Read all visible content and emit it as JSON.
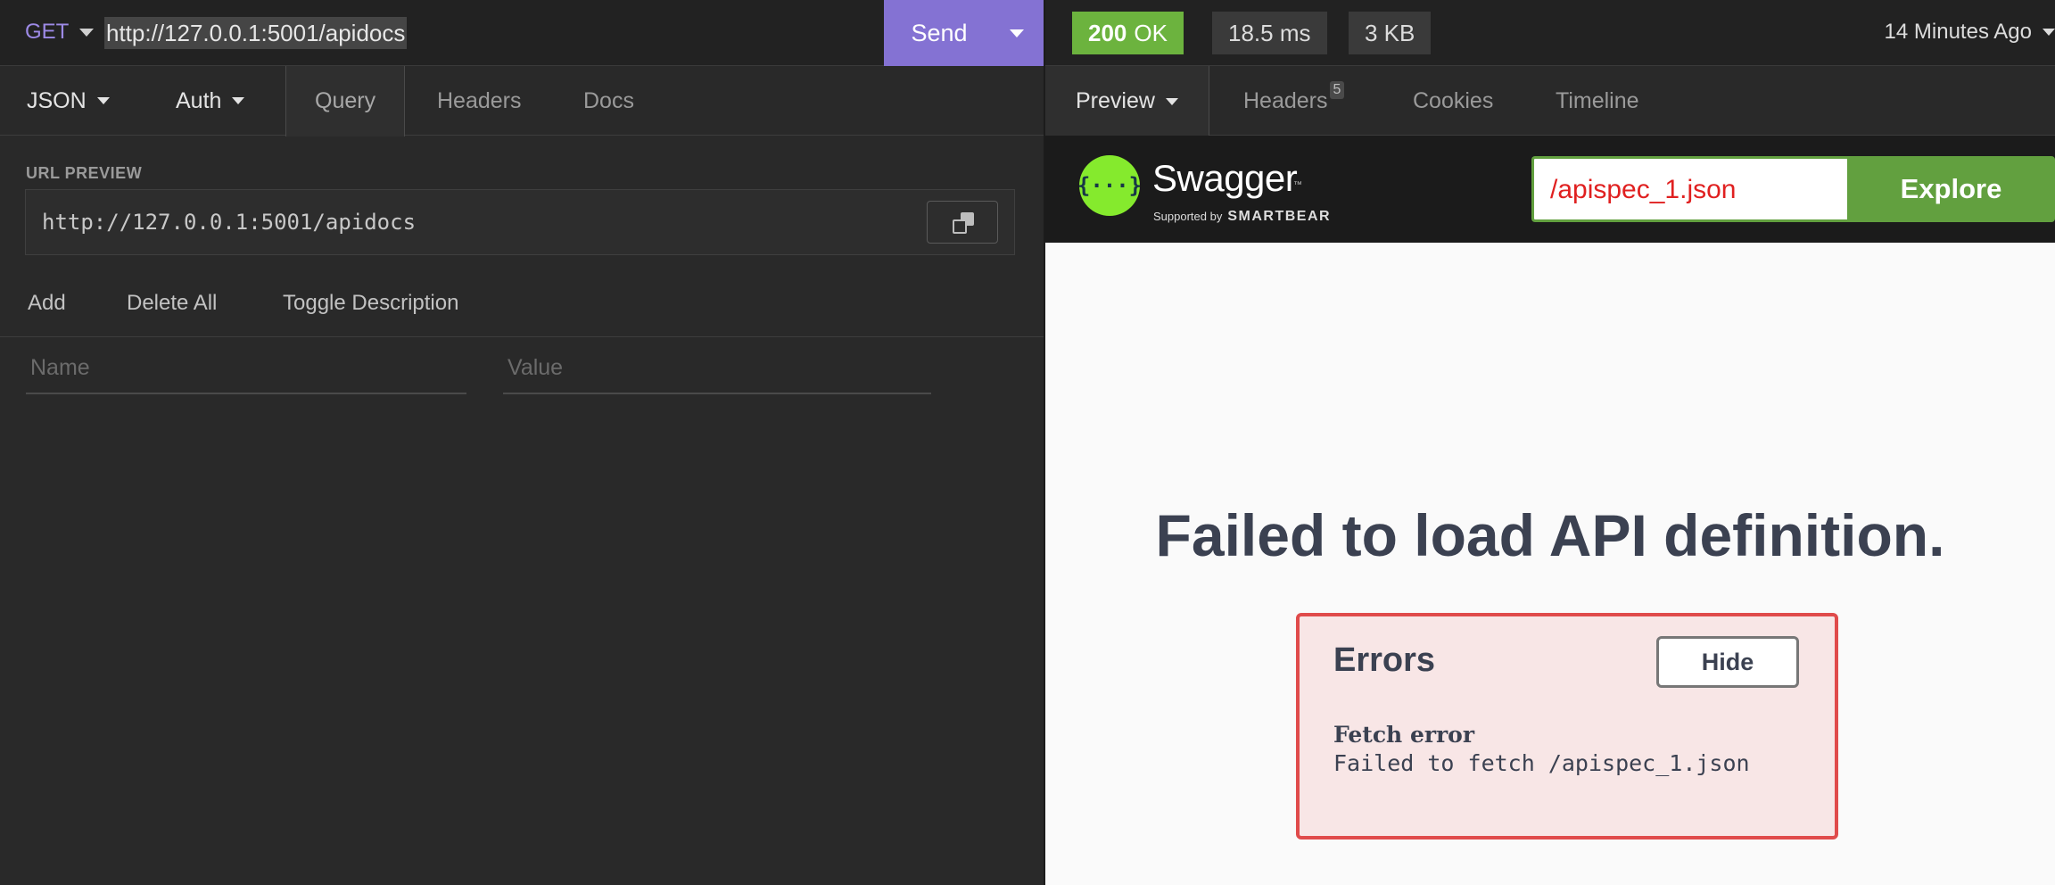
{
  "request": {
    "method": "GET",
    "url": "http://127.0.0.1:5001/apidocs",
    "send_label": "Send"
  },
  "request_tabs": {
    "body": "JSON",
    "auth": "Auth",
    "query": "Query",
    "headers": "Headers",
    "docs": "Docs"
  },
  "url_preview": {
    "label": "URL PREVIEW",
    "value": "http://127.0.0.1:5001/apidocs"
  },
  "query_actions": {
    "add": "Add",
    "delete_all": "Delete All",
    "toggle_description": "Toggle Description"
  },
  "params": {
    "name_placeholder": "Name",
    "value_placeholder": "Value"
  },
  "response": {
    "status_code": "200",
    "status_text": "OK",
    "time": "18.5 ms",
    "size": "3 KB",
    "ago": "14 Minutes Ago"
  },
  "response_tabs": {
    "preview": "Preview",
    "headers": "Headers",
    "headers_count": "5",
    "cookies": "Cookies",
    "timeline": "Timeline"
  },
  "swagger": {
    "logo_glyph": "{···}",
    "name": "Swagger",
    "tm": "™",
    "supported_by": "Supported by",
    "smartbear": "SMARTBEAR",
    "spec_input": "/apispec_1.json",
    "explore_label": "Explore",
    "fail_title": "Failed to load API definition.",
    "errors_title": "Errors",
    "hide_label": "Hide",
    "error_type": "Fetch error",
    "error_message": "Failed to fetch /apispec_1.json"
  },
  "colors": {
    "send": "#8472d3",
    "ok": "#6cb33e",
    "swagger_green": "#62a03f",
    "error_border": "#e04b4b"
  }
}
